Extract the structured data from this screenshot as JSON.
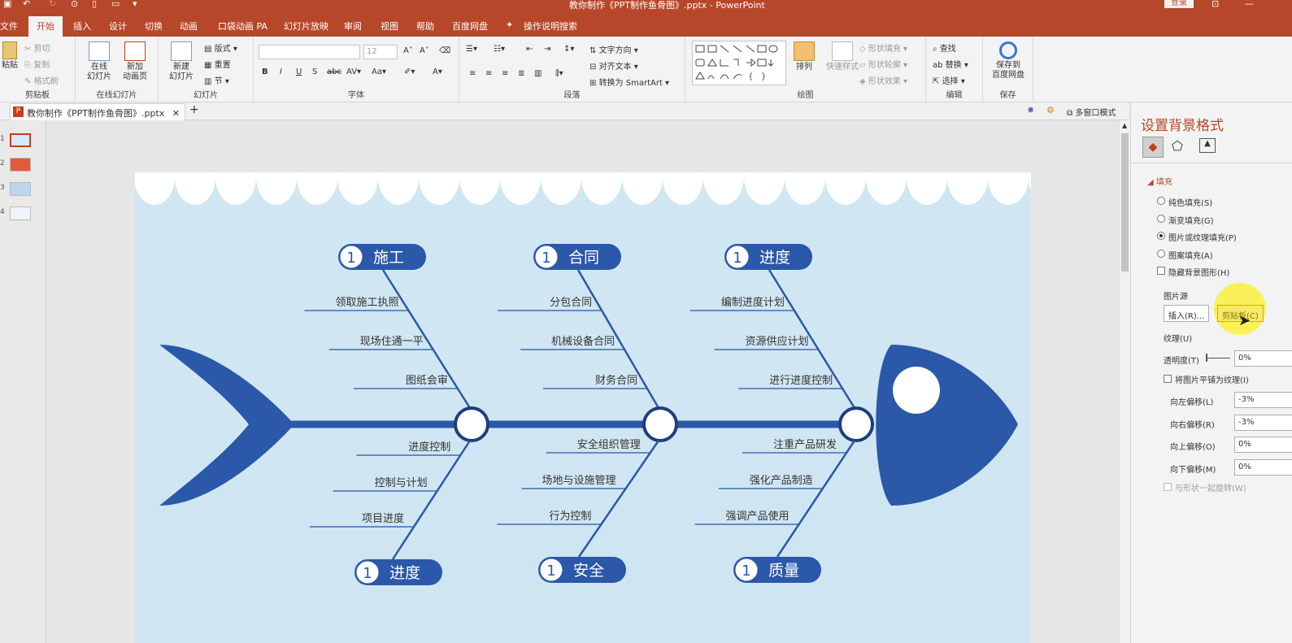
{
  "titlebar": {
    "doc_title": "教你制作《PPT制作鱼骨图》.pptx - PowerPoint",
    "login_label": "登录"
  },
  "tabs": [
    {
      "label": "文件"
    },
    {
      "label": "开始"
    },
    {
      "label": "插入"
    },
    {
      "label": "设计"
    },
    {
      "label": "切换"
    },
    {
      "label": "动画"
    },
    {
      "label": "口袋动画 PA"
    },
    {
      "label": "幻灯片放映"
    },
    {
      "label": "审阅"
    },
    {
      "label": "视图"
    },
    {
      "label": "帮助"
    },
    {
      "label": "百度网盘"
    },
    {
      "label": "操作说明搜索"
    }
  ],
  "ribbon": {
    "clipboard": {
      "paste": "粘贴",
      "cut": "剪切",
      "copy": "复制",
      "format_painter": "格式刷",
      "label": "剪贴板"
    },
    "online": {
      "online_slides": "在线\n幻灯片",
      "new_anim": "新加\n动画页",
      "label": "在线幻灯片"
    },
    "slides": {
      "new_slide": "新建\n幻灯片",
      "layout": "版式",
      "reset": "重置",
      "section": "节",
      "label": "幻灯片"
    },
    "font": {
      "size": "12",
      "label": "字体"
    },
    "paragraph": {
      "text_direction": "文字方向",
      "align_text": "对齐文本",
      "smartart": "转换为 SmartArt",
      "label": "段落"
    },
    "drawing": {
      "arrange": "排列",
      "quick_styles": "快速样式",
      "shape_fill": "形状填充",
      "shape_outline": "形状轮廓",
      "shape_effects": "形状效果",
      "label": "绘图"
    },
    "editing": {
      "find": "查找",
      "replace": "替换",
      "select": "选择",
      "label": "编辑"
    },
    "save": {
      "save_baidu": "保存到\n百度网盘",
      "label": "保存"
    }
  },
  "doc_tab": {
    "name": "教你制作《PPT制作鱼骨图》.pptx",
    "multi_window": "多窗口模式"
  },
  "thumbnails": [
    {
      "num": "1"
    },
    {
      "num": "2"
    },
    {
      "num": "3"
    },
    {
      "num": "4"
    }
  ],
  "slide": {
    "categories": [
      {
        "num": "1",
        "label": "施工",
        "items": [
          "领取施工执照",
          "现场住通一平",
          "图纸会审"
        ]
      },
      {
        "num": "1",
        "label": "合同",
        "items": [
          "分包合同",
          "机械设备合同",
          "财务合同"
        ]
      },
      {
        "num": "1",
        "label": "进度",
        "items": [
          "编制进度计划",
          "资源供应计划",
          "进行进度控制"
        ]
      },
      {
        "num": "1",
        "label": "进度",
        "items": [
          "进度控制",
          "控制与计划",
          "项目进度"
        ]
      },
      {
        "num": "1",
        "label": "安全",
        "items": [
          "安全组织管理",
          "场地与设施管理",
          "行为控制"
        ]
      },
      {
        "num": "1",
        "label": "质量",
        "items": [
          "注重产品研发",
          "强化产品制造",
          "强调产品使用"
        ]
      }
    ]
  },
  "pane": {
    "title": "设置背景格式",
    "fill_header": "填充",
    "fill_options": [
      "纯色填充(S)",
      "渐变填充(G)",
      "图片或纹理填充(P)",
      "图案填充(A)"
    ],
    "selected_fill": 2,
    "hide_bg_graphics": "隐藏背景图形(H)",
    "image_source": "图片源",
    "insert_btn": "插入(R)...",
    "clipboard_btn": "剪贴板(C)",
    "texture": "纹理(U)",
    "transparency_label": "透明度(T)",
    "transparency_value": "0%",
    "tile": "将图片平铺为纹理(I)",
    "offsets": [
      {
        "label": "向左偏移(L)",
        "value": "-3%"
      },
      {
        "label": "向右偏移(R)",
        "value": "-3%"
      },
      {
        "label": "向上偏移(O)",
        "value": "0%"
      },
      {
        "label": "向下偏移(M)",
        "value": "0%"
      }
    ],
    "rotate_with_shape": "与形状一起旋转(W)"
  },
  "colors": {
    "accent": "#b7472a",
    "fish_blue": "#2b58a8",
    "slide_bg": "#d5eaf4"
  }
}
